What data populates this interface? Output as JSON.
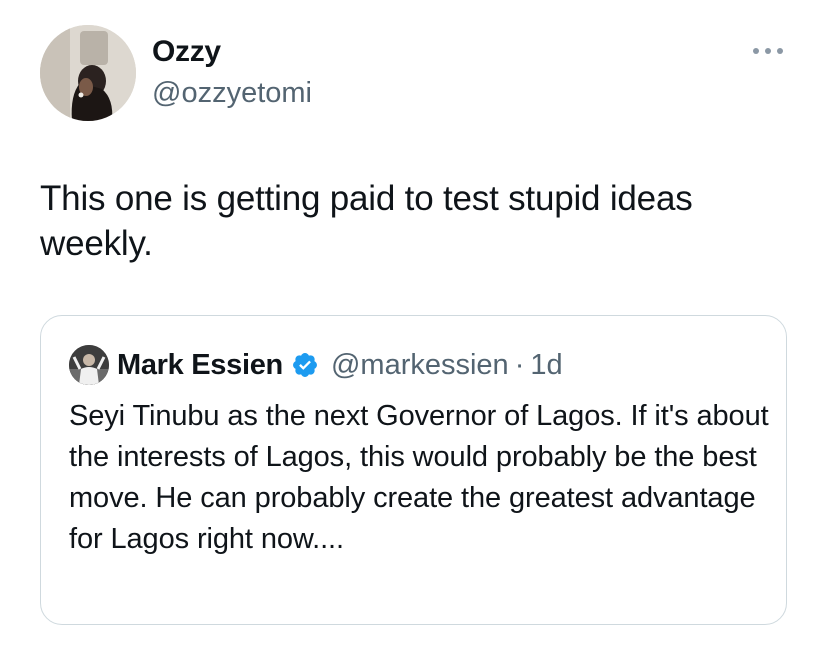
{
  "author": {
    "name": "Ozzy",
    "handle": "@ozzyetomi",
    "avatar_icon": "profile-photo"
  },
  "tweet": {
    "text": "This one is getting paid to test stupid ideas weekly."
  },
  "more_icon": "more-horizontal-icon",
  "quoted_tweet": {
    "author_name": "Mark Essien",
    "verified": true,
    "handle": "@markessien",
    "separator": "·",
    "time": "1d",
    "text": "Seyi Tinubu as the next Governor of Lagos. If it's about the interests of Lagos, this would probably be the best move. He can probably create the greatest advantage for Lagos right now...."
  },
  "colors": {
    "text_primary": "#0f1419",
    "text_secondary": "#536471",
    "border": "#cfd9de",
    "verified_blue": "#1d9bf0"
  }
}
